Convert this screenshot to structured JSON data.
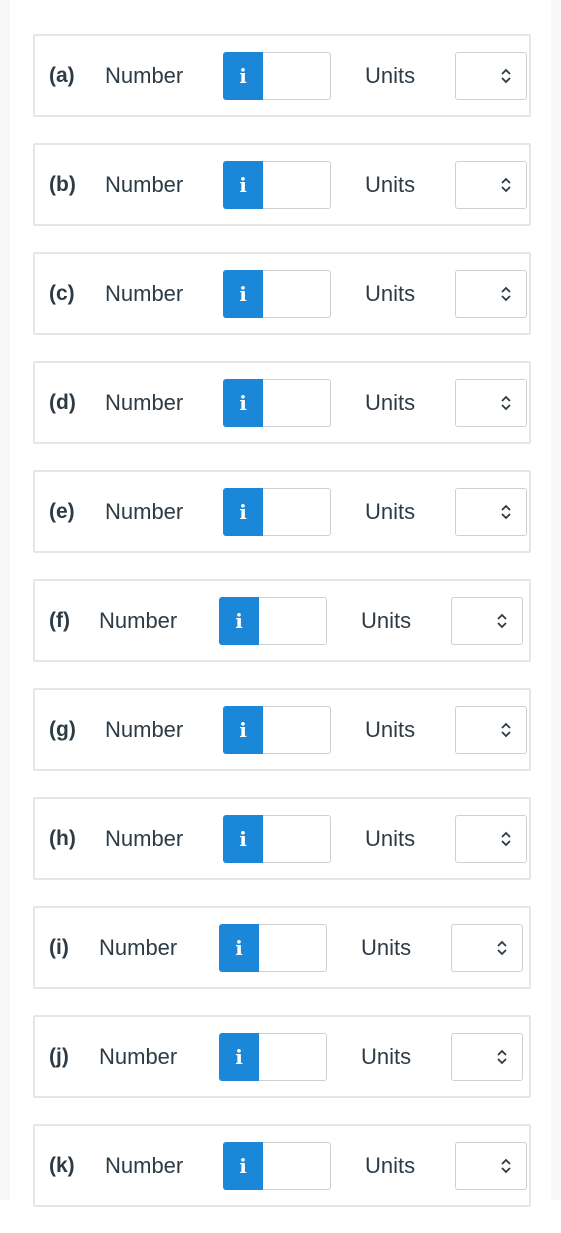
{
  "questions": [
    {
      "part": "(a)",
      "number_label": "Number",
      "number_value": "",
      "units_label": "Units",
      "units_value": ""
    },
    {
      "part": "(b)",
      "number_label": "Number",
      "number_value": "",
      "units_label": "Units",
      "units_value": ""
    },
    {
      "part": "(c)",
      "number_label": "Number",
      "number_value": "",
      "units_label": "Units",
      "units_value": ""
    },
    {
      "part": "(d)",
      "number_label": "Number",
      "number_value": "",
      "units_label": "Units",
      "units_value": ""
    },
    {
      "part": "(e)",
      "number_label": "Number",
      "number_value": "",
      "units_label": "Units",
      "units_value": ""
    },
    {
      "part": "(f)",
      "number_label": "Number",
      "number_value": "",
      "units_label": "Units",
      "units_value": ""
    },
    {
      "part": "(g)",
      "number_label": "Number",
      "number_value": "",
      "units_label": "Units",
      "units_value": ""
    },
    {
      "part": "(h)",
      "number_label": "Number",
      "number_value": "",
      "units_label": "Units",
      "units_value": ""
    },
    {
      "part": "(i)",
      "number_label": "Number",
      "number_value": "",
      "units_label": "Units",
      "units_value": ""
    },
    {
      "part": "(j)",
      "number_label": "Number",
      "number_value": "",
      "units_label": "Units",
      "units_value": ""
    },
    {
      "part": "(k)",
      "number_label": "Number",
      "number_value": "",
      "units_label": "Units",
      "units_value": ""
    }
  ],
  "info_glyph": "i",
  "icons": {
    "info": "info-icon",
    "select": "chevron-up-down-icon"
  },
  "colors": {
    "accent": "#1b87d9",
    "text": "#2d3b45",
    "border": "#e6e6e6"
  }
}
